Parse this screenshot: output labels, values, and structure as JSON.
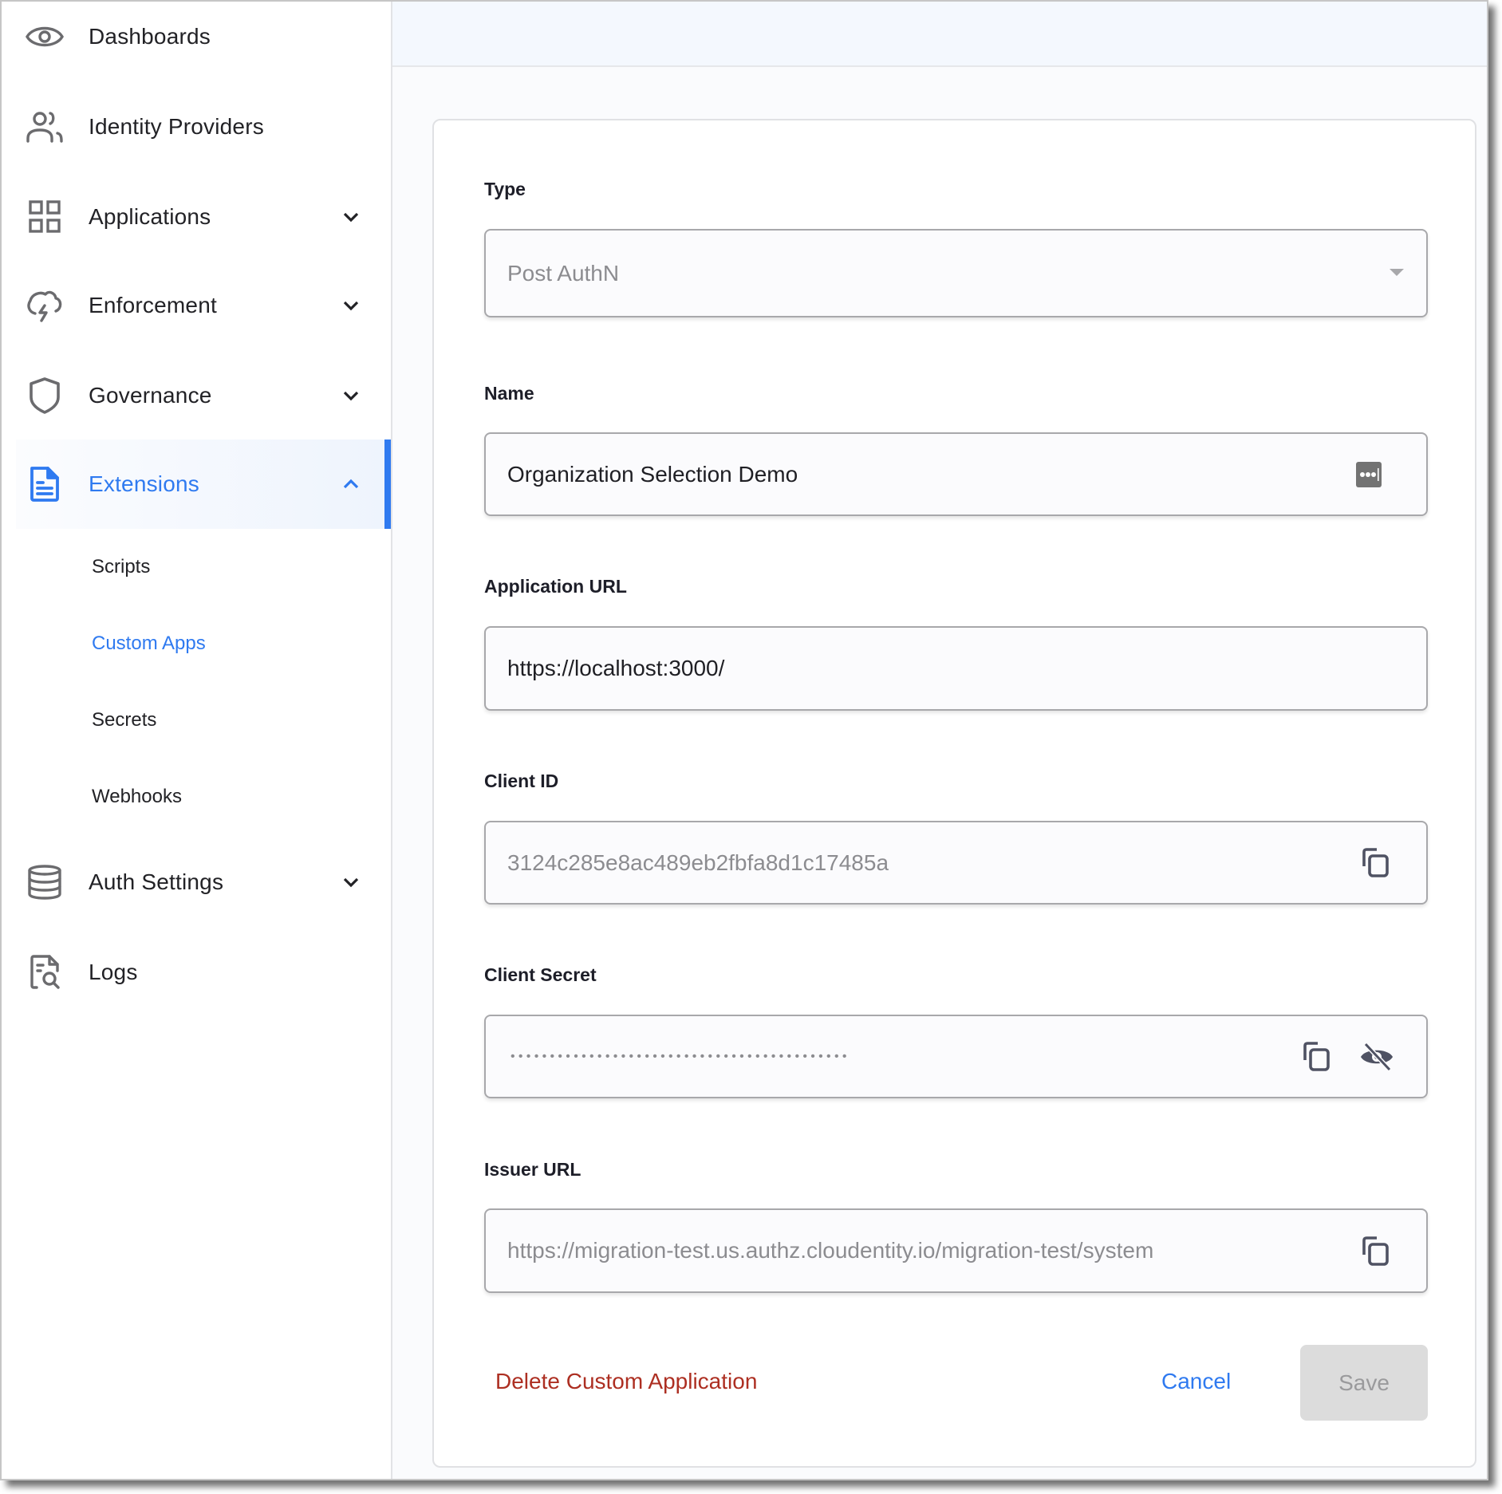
{
  "sidebar": {
    "items": [
      {
        "label": "Dashboards",
        "icon": "eye-icon"
      },
      {
        "label": "Identity Providers",
        "icon": "users-icon"
      },
      {
        "label": "Applications",
        "icon": "grid-icon",
        "expandable": true
      },
      {
        "label": "Enforcement",
        "icon": "cloud-lightning-icon",
        "expandable": true
      },
      {
        "label": "Governance",
        "icon": "shield-icon",
        "expandable": true
      },
      {
        "label": "Extensions",
        "icon": "document-icon",
        "expandable": true,
        "expanded": true,
        "active": true
      },
      {
        "label": "Auth Settings",
        "icon": "database-icon",
        "expandable": true
      },
      {
        "label": "Logs",
        "icon": "log-search-icon"
      }
    ],
    "extensions_sub": [
      {
        "label": "Scripts"
      },
      {
        "label": "Custom Apps",
        "active": true
      },
      {
        "label": "Secrets"
      },
      {
        "label": "Webhooks"
      }
    ]
  },
  "form": {
    "type": {
      "label": "Type",
      "value": "Post AuthN"
    },
    "name": {
      "label": "Name",
      "value": "Organization Selection Demo"
    },
    "app_url": {
      "label": "Application URL",
      "value": "https://localhost:3000/"
    },
    "client_id": {
      "label": "Client ID",
      "value": "3124c285e8ac489eb2fbfa8d1c17485a"
    },
    "client_secret": {
      "label": "Client Secret",
      "masked_value": "•••••••••••••••••••••••••••••••••••••••••••"
    },
    "issuer_url": {
      "label": "Issuer URL",
      "value": "https://migration-test.us.authz.cloudentity.io/migration-test/system"
    }
  },
  "actions": {
    "delete_label": "Delete Custom Application",
    "cancel_label": "Cancel",
    "save_label": "Save"
  },
  "colors": {
    "accent": "#2f7af0",
    "danger": "#ad2f22",
    "disabled_bg": "#dcdcdc"
  }
}
